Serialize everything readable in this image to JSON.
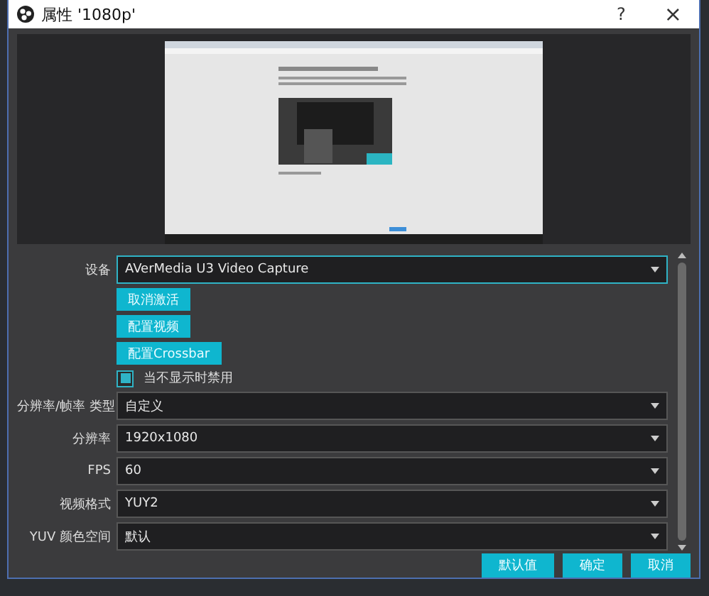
{
  "window": {
    "title": "属性 '1080p'",
    "help": "?",
    "close": "×"
  },
  "device": {
    "label": "设备",
    "value": "AVerMedia U3 Video Capture",
    "focused": true
  },
  "actions": [
    "取消激活",
    "配置视频",
    "配置Crossbar"
  ],
  "checkbox": {
    "label": "当不显示时禁用",
    "checked": true
  },
  "fields": [
    {
      "label": "分辨率/帧率 类型",
      "value": "自定义"
    },
    {
      "label": "分辨率",
      "value": "1920x1080"
    },
    {
      "label": "FPS",
      "value": "60"
    },
    {
      "label": "视频格式",
      "value": "YUY2"
    },
    {
      "label": "YUV 颜色空间",
      "value": "默认"
    }
  ],
  "buttons": [
    "默认值",
    "确定",
    "取消"
  ]
}
